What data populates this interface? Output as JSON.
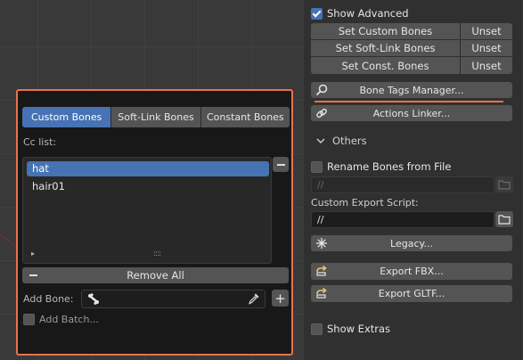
{
  "popup": {
    "tabs": [
      {
        "label": "Custom Bones",
        "active": true
      },
      {
        "label": "Soft-Link Bones",
        "active": false
      },
      {
        "label": "Constant Bones",
        "active": false
      }
    ],
    "cc_list_label": "Cc list:",
    "list_items": [
      {
        "label": "hat",
        "selected": true
      },
      {
        "label": "hair01",
        "selected": false
      }
    ],
    "list_arrow": "▸",
    "list_grip": "::::",
    "remove_all_label": "Remove All",
    "add_bone_label": "Add Bone:",
    "add_bone_value": "",
    "plus_label": "+",
    "add_batch_label": "Add Batch..."
  },
  "panel": {
    "show_advanced": {
      "label": "Show Advanced",
      "checked": true
    },
    "bone_sets": [
      {
        "label": "Set Custom Bones",
        "action": "Unset"
      },
      {
        "label": "Set Soft-Link Bones",
        "action": "Unset"
      },
      {
        "label": "Set Const. Bones",
        "action": "Unset"
      }
    ],
    "bone_tags_manager_label": "Bone Tags Manager...",
    "actions_linker_label": "Actions Linker...",
    "others_label": "Others",
    "rename_bones": {
      "label": "Rename Bones from File",
      "checked": false
    },
    "rename_path": "//",
    "custom_export_label": "Custom Export Script:",
    "custom_export_path": "//",
    "legacy_label": "Legacy...",
    "export_fbx_label": "Export FBX...",
    "export_gltf_label": "Export GLTF...",
    "show_extras": {
      "label": "Show Extras",
      "checked": false
    }
  },
  "colors": {
    "accent": "#4772b3",
    "highlight_border": "#e8734a",
    "button": "#545454",
    "panel_bg": "#303030"
  }
}
